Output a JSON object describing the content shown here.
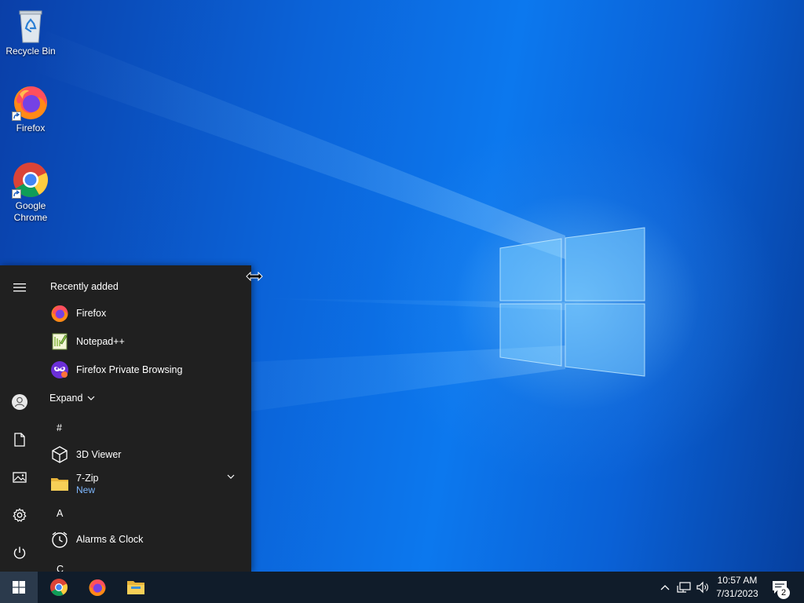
{
  "desktop": {
    "icons": [
      {
        "label": "Recycle Bin",
        "icon": "recycle-bin-icon"
      },
      {
        "label": "Firefox",
        "icon": "firefox-icon"
      },
      {
        "label": "Google Chrome",
        "icon": "chrome-icon"
      }
    ]
  },
  "start_menu": {
    "recently_added_label": "Recently added",
    "recent": [
      {
        "label": "Firefox",
        "icon": "firefox-icon"
      },
      {
        "label": "Notepad++",
        "icon": "notepadpp-icon"
      },
      {
        "label": "Firefox Private Browsing",
        "icon": "firefox-private-icon"
      }
    ],
    "expand_label": "Expand",
    "groups": {
      "hash": "#",
      "a": "A",
      "c": "C"
    },
    "apps": {
      "viewer3d": {
        "label": "3D Viewer",
        "icon": "cube-icon"
      },
      "sevenzip": {
        "label": "7-Zip",
        "sub": "New",
        "icon": "folder-icon"
      },
      "alarms": {
        "label": "Alarms & Clock",
        "icon": "alarm-clock-icon"
      }
    },
    "rail": [
      "menu-icon",
      "user-icon",
      "document-icon",
      "pictures-icon",
      "settings-icon",
      "power-icon"
    ]
  },
  "taskbar": {
    "pinned": [
      "chrome-icon",
      "firefox-icon",
      "file-explorer-icon"
    ],
    "clock": {
      "time": "10:57 AM",
      "date": "7/31/2023"
    },
    "notifications_count": "2"
  },
  "colors": {
    "start_bg": "#202020",
    "taskbar_bg": "#101c2a",
    "accent_new": "#7fb8ff"
  }
}
